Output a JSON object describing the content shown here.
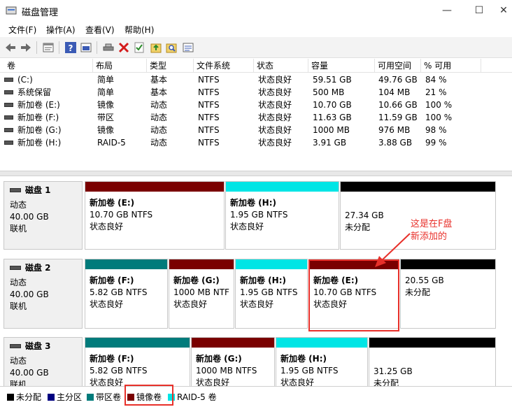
{
  "window": {
    "title": "磁盘管理",
    "min_glyph": "—",
    "max_glyph": "☐",
    "close_glyph": "✕"
  },
  "menu": [
    "文件(F)",
    "操作(A)",
    "查看(V)",
    "帮助(H)"
  ],
  "toolbar_icons": [
    "back-icon",
    "forward-icon",
    "properties-icon",
    "help-icon",
    "console-icon",
    "connect-icon",
    "delete-icon",
    "check-icon",
    "import-icon",
    "search-icon",
    "list-icon"
  ],
  "volume_table": {
    "headers": [
      "卷",
      "布局",
      "类型",
      "文件系统",
      "状态",
      "容量",
      "可用空间",
      "% 可用"
    ],
    "rows": [
      [
        "(C:)",
        "简单",
        "基本",
        "NTFS",
        "状态良好",
        "59.51 GB",
        "49.76 GB",
        "84 %"
      ],
      [
        "系统保留",
        "简单",
        "基本",
        "NTFS",
        "状态良好",
        "500 MB",
        "104 MB",
        "21 %"
      ],
      [
        "新加卷 (E:)",
        "镜像",
        "动态",
        "NTFS",
        "状态良好",
        "10.70 GB",
        "10.66 GB",
        "100 %"
      ],
      [
        "新加卷 (F:)",
        "带区",
        "动态",
        "NTFS",
        "状态良好",
        "11.63 GB",
        "11.59 GB",
        "100 %"
      ],
      [
        "新加卷 (G:)",
        "镜像",
        "动态",
        "NTFS",
        "状态良好",
        "1000 MB",
        "976 MB",
        "98 %"
      ],
      [
        "新加卷 (H:)",
        "RAID-5",
        "动态",
        "NTFS",
        "状态良好",
        "3.91 GB",
        "3.88 GB",
        "99 %"
      ]
    ]
  },
  "disks": [
    {
      "name": "磁盘 1",
      "type": "动态",
      "size": "40.00 GB",
      "status": "联机",
      "partitions": [
        {
          "name": "新加卷 (E:)",
          "size": "10.70 GB NTFS",
          "status": "状态良好",
          "color": "#7a0000"
        },
        {
          "name": "新加卷 (H:)",
          "size": "1.95 GB NTFS",
          "status": "状态良好",
          "color": "#00e5e5"
        },
        {
          "name": "",
          "size": "27.34 GB",
          "status": "未分配",
          "color": "#000000"
        }
      ]
    },
    {
      "name": "磁盘 2",
      "type": "动态",
      "size": "40.00 GB",
      "status": "联机",
      "partitions": [
        {
          "name": "新加卷 (F:)",
          "size": "5.82 GB NTFS",
          "status": "状态良好",
          "color": "#007b7b"
        },
        {
          "name": "新加卷 (G:)",
          "size": "1000 MB NTF",
          "status": "状态良好",
          "color": "#7a0000"
        },
        {
          "name": "新加卷 (H:)",
          "size": "1.95 GB NTFS",
          "status": "状态良好",
          "color": "#00e5e5"
        },
        {
          "name": "新加卷 (E:)",
          "size": "10.70 GB NTFS",
          "status": "状态良好",
          "color": "#7a0000"
        },
        {
          "name": "",
          "size": "20.55 GB",
          "status": "未分配",
          "color": "#000000"
        }
      ]
    },
    {
      "name": "磁盘 3",
      "type": "动态",
      "size": "40.00 GB",
      "status": "联机",
      "partitions": [
        {
          "name": "新加卷 (F:)",
          "size": "5.82 GB NTFS",
          "status": "状态良好",
          "color": "#007b7b"
        },
        {
          "name": "新加卷 (G:)",
          "size": "1000 MB NTFS",
          "status": "状态良好",
          "color": "#7a0000"
        },
        {
          "name": "新加卷 (H:)",
          "size": "1.95 GB NTFS",
          "status": "状态良好",
          "color": "#00e5e5"
        },
        {
          "name": "",
          "size": "31.25 GB",
          "status": "未分配",
          "color": "#000000"
        }
      ]
    }
  ],
  "annotation": {
    "line1": "这是在F盘",
    "line2": "新添加的",
    "color": "#e8302a"
  },
  "legend": [
    {
      "label": "未分配",
      "color": "#000000"
    },
    {
      "label": "主分区",
      "color": "#000080"
    },
    {
      "label": "带区卷",
      "color": "#007b7b"
    },
    {
      "label": "镜像卷",
      "color": "#7a0000"
    },
    {
      "label": "RAID-5 卷",
      "color": "#00e5e5"
    }
  ]
}
